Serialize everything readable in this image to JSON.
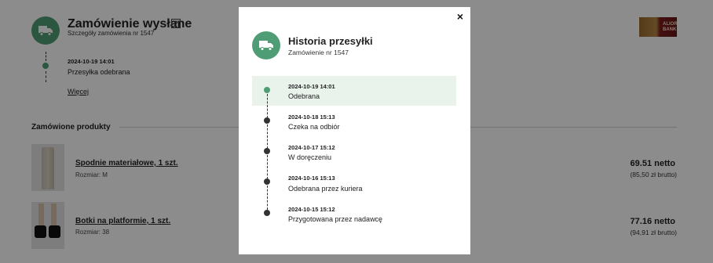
{
  "order": {
    "title": "Zamówienie wysłane",
    "help": "?",
    "subtitle": "Szczegóły zamówienia nr 1547",
    "bank_logo_text": "ALIOR BANK",
    "last_event": {
      "date": "2024-10-19 14:01",
      "status": "Przesyłka odebrana"
    },
    "more_label": "Więcej"
  },
  "products": {
    "section_title": "Zamówione produkty",
    "items": [
      {
        "name": "Spodnie materiałowe, 1 szt.",
        "size": "Rozmiar: M",
        "net": "69.51 netto",
        "gross": "(85,50 zł brutto)",
        "image_icon": "trousers-image"
      },
      {
        "name": "Botki na platformie, 1 szt.",
        "size": "Rozmiar: 38",
        "net": "77.16 netto",
        "gross": "(94,91 zł brutto)",
        "image_icon": "boots-image"
      }
    ]
  },
  "modal": {
    "close": "×",
    "title": "Historia przesyłki",
    "subtitle": "Zamówienie nr 1547",
    "events": [
      {
        "date": "2024-10-19 14:01",
        "status": "Odebrana",
        "active": true
      },
      {
        "date": "2024-10-18 15:13",
        "status": "Czeka na odbiór",
        "active": false
      },
      {
        "date": "2024-10-17 15:12",
        "status": "W doręczeniu",
        "active": false
      },
      {
        "date": "2024-10-16 15:13",
        "status": "Odebrana przez kuriera",
        "active": false
      },
      {
        "date": "2024-10-15 15:12",
        "status": "Przygotowana przez nadawcę",
        "active": false
      }
    ]
  },
  "colors": {
    "accent": "#4f9d75",
    "highlight": "#e9f3ec",
    "overlay": "rgba(0,0,0,0.45)"
  },
  "icons": {
    "truck": "truck-icon",
    "close": "close-icon"
  }
}
